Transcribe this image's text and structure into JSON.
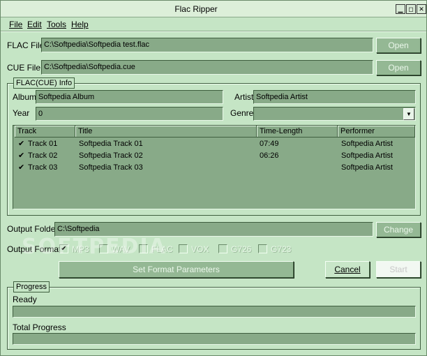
{
  "window": {
    "title": "Flac Ripper",
    "controls": {
      "minimize": "▁",
      "restore": "◻",
      "close": "✕"
    }
  },
  "menu": [
    "File",
    "Edit",
    "Tools",
    "Help"
  ],
  "flac_file": {
    "label": "FLAC File",
    "value": "C:\\Softpedia\\Softpedia test.flac",
    "button": "Open"
  },
  "cue_file": {
    "label": "CUE File",
    "value": "C:\\Softpedia\\Softpedia.cue",
    "button": "Open"
  },
  "info": {
    "title": "FLAC(CUE) Info",
    "album_label": "Album",
    "album": "Softpedia Album",
    "artist_label": "Artist",
    "artist": "Softpedia Artist",
    "year_label": "Year",
    "year": "0",
    "genre_label": "Genre",
    "genre": "",
    "columns": [
      "Track",
      "Title",
      "Time-Length",
      "Performer"
    ],
    "tracks": [
      {
        "checked": true,
        "track": "Track 01",
        "title": "Softpedia Track 01",
        "time": "07:49",
        "performer": "Softpedia Artist"
      },
      {
        "checked": true,
        "track": "Track 02",
        "title": "Softpedia Track 02",
        "time": "06:26",
        "performer": "Softpedia Artist"
      },
      {
        "checked": true,
        "track": "Track 03",
        "title": "Softpedia Track 03",
        "time": "",
        "performer": "Softpedia Artist"
      }
    ]
  },
  "output_folder": {
    "label": "Output Folder",
    "value": "C:\\Softpedia",
    "button": "Change"
  },
  "output_format": {
    "label": "Output Format:",
    "options": [
      {
        "name": "MP3",
        "checked": true
      },
      {
        "name": "WAV",
        "checked": false
      },
      {
        "name": "FLAC",
        "checked": false
      },
      {
        "name": "VOX",
        "checked": false
      },
      {
        "name": "G726",
        "checked": false
      },
      {
        "name": "G723",
        "checked": false
      }
    ]
  },
  "buttons": {
    "set_params": "Set Format Parameters",
    "cancel": "Cancel",
    "start": "Start"
  },
  "progress": {
    "title": "Progress",
    "status": "Ready",
    "status_fraction": 0,
    "total_label": "Total Progress",
    "total_fraction": 0
  },
  "watermark": "SOFTPEDIA"
}
